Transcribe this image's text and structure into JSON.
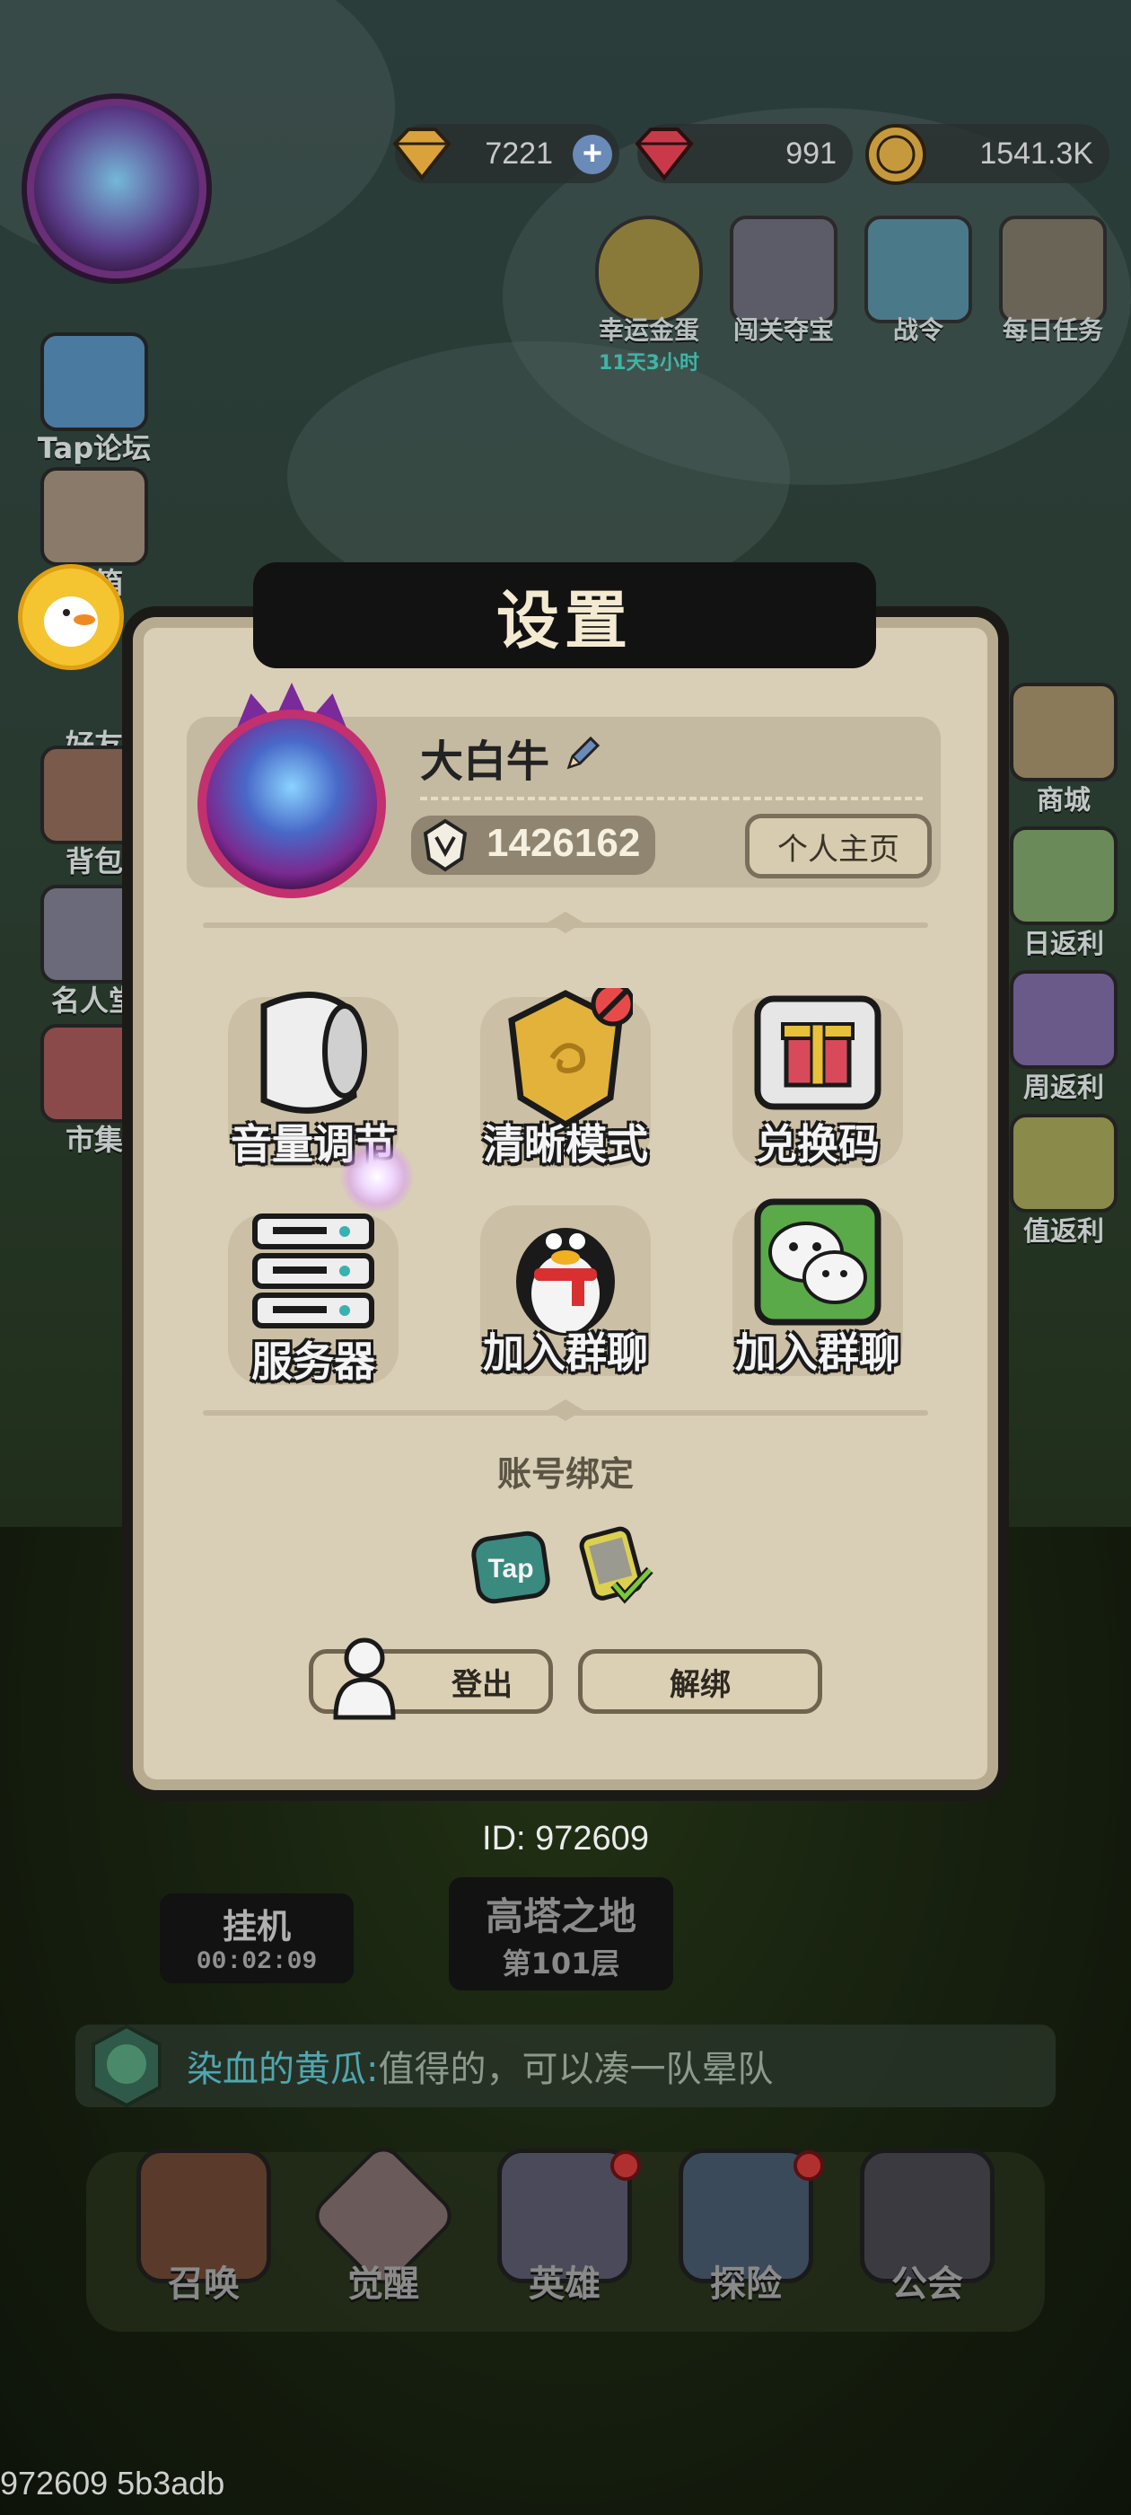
{
  "resources": {
    "gold": "7221",
    "gems": "991",
    "coins": "1541.3K"
  },
  "top_icons": [
    {
      "label": "幸运金蛋",
      "sub": "11天3小时"
    },
    {
      "label": "闯关夺宝"
    },
    {
      "label": "战令"
    },
    {
      "label": "每日任务"
    }
  ],
  "left_icons": [
    "Tap论坛",
    "邮箱",
    "好友",
    "背包",
    "名人堂",
    "市集"
  ],
  "right_icons": [
    "商城",
    "日返利",
    "周返利",
    "值返利"
  ],
  "dialog": {
    "title": "设置",
    "name": "大白牛",
    "power": "1426162",
    "home_button": "个人主页",
    "tiles": [
      {
        "label": "音量调节",
        "icon": "speaker-icon"
      },
      {
        "label": "清晰模式",
        "icon": "shield-icon"
      },
      {
        "label": "兑换码",
        "icon": "gift-icon"
      },
      {
        "label": "服务器",
        "icon": "server-icon"
      },
      {
        "label": "加入群聊",
        "icon": "qq-penguin-icon"
      },
      {
        "label": "加入群聊",
        "icon": "wechat-icon"
      }
    ],
    "bind_title": "账号绑定",
    "tap_label": "Tap",
    "logout_button": "登出",
    "unbind_button": "解绑"
  },
  "player_id": "ID: 972609",
  "idle": {
    "label": "挂机",
    "time": "00:02:09"
  },
  "tower": {
    "label": "高塔之地",
    "floor": "第101层"
  },
  "chat": {
    "user": "染血的黄瓜:",
    "message": " 值得的，可以凑一队晕队"
  },
  "bottom_nav": [
    "召唤",
    "觉醒",
    "英雄",
    "探险",
    "公会"
  ],
  "debug_text": "972609 5b3adb",
  "colors": {
    "panel": "#d9cfb6",
    "title_bar": "#121212",
    "wechat_green": "#5aaa4a",
    "chat_user": "#4fa6b0"
  }
}
